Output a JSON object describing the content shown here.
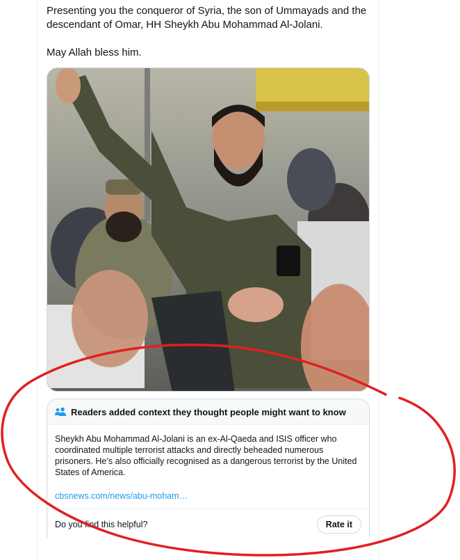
{
  "tweet": {
    "line1": "Presenting you the conqueror of Syria, the son of Ummayads and the descendant of Omar, HH Sheykh Abu Mohammad Al-Jolani.",
    "line2": "May Allah bless him."
  },
  "media": {
    "alt_subject": "photo"
  },
  "community_note": {
    "header_icon": "people-icon",
    "header_title": "Readers added context they thought people might want to know",
    "body": "Sheykh Abu Mohammad Al-Jolani is an ex-Al-Qaeda and ISIS officer who coordinated multiple terrorist attacks and directly beheaded numerous prisoners. He’s also officially recognised as a dangerous terrorist by the United States of America.",
    "link": "cbsnews.com/news/abu-moham…",
    "question": "Do you find this helpful?",
    "rate_label": "Rate it"
  },
  "colors": {
    "link": "#1d9bf0",
    "annotation": "#e02020",
    "border": "#cfd9de"
  }
}
